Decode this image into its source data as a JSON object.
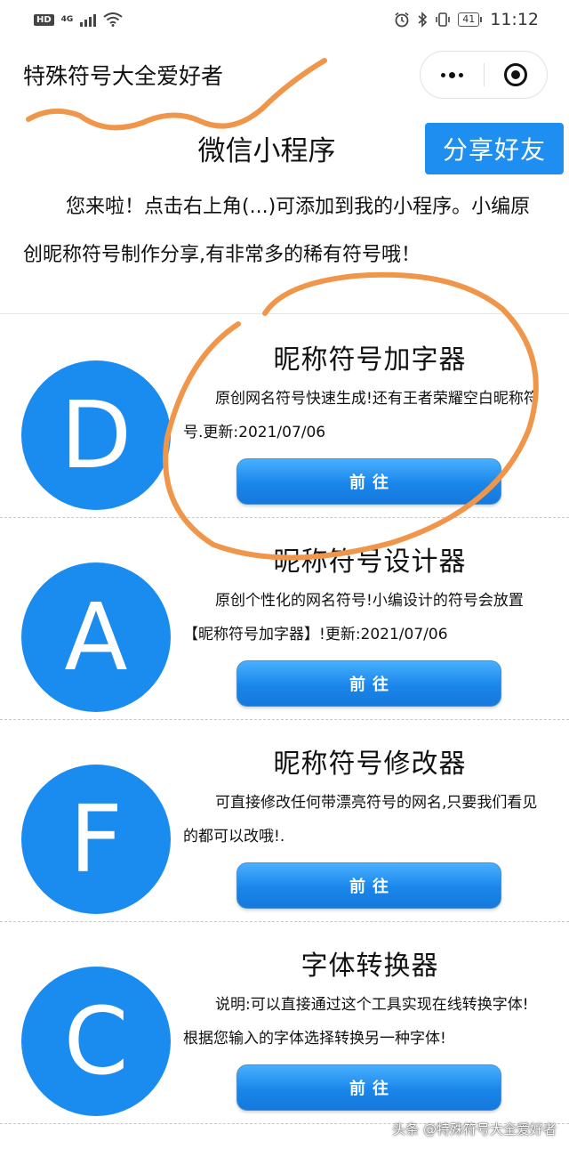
{
  "status_bar": {
    "hd": "HD",
    "network": "4G",
    "battery": "41",
    "time": "11:12",
    "icons": [
      "alarm-icon",
      "bluetooth-icon",
      "vibrate-icon"
    ]
  },
  "header": {
    "title": "特殊符号大全爱好者"
  },
  "intro": {
    "mini_title": "微信小程序",
    "share_label": "分享好友",
    "text": "您来啦！点击右上角(...)可添加到我的小程序。小编原创昵称符号制作分享,有非常多的稀有符号哦！"
  },
  "tools": [
    {
      "letter": "D",
      "name": "昵称符号加字器",
      "desc": "原创网名符号快速生成!还有王者荣耀空白昵称符号.更新:2021/07/06",
      "button": "前往"
    },
    {
      "letter": "A",
      "name": "昵称符号设计器",
      "desc": "原创个性化的网名符号!小编设计的符号会放置【昵称符号加字器】!更新:2021/07/06",
      "button": "前往"
    },
    {
      "letter": "F",
      "name": "昵称符号修改器",
      "desc": "可直接修改任何带漂亮符号的网名,只要我们看见的都可以改哦!.",
      "button": "前往"
    },
    {
      "letter": "C",
      "name": "字体转换器",
      "desc": "说明:可以直接通过这个工具实现在线转换字体!根据您输入的字体选择转换另一种字体!",
      "button": "前往"
    }
  ],
  "watermark": "头条 @特殊符号大全爱好者",
  "colors": {
    "accent": "#1a8cf0",
    "annotation": "#f0964a"
  }
}
